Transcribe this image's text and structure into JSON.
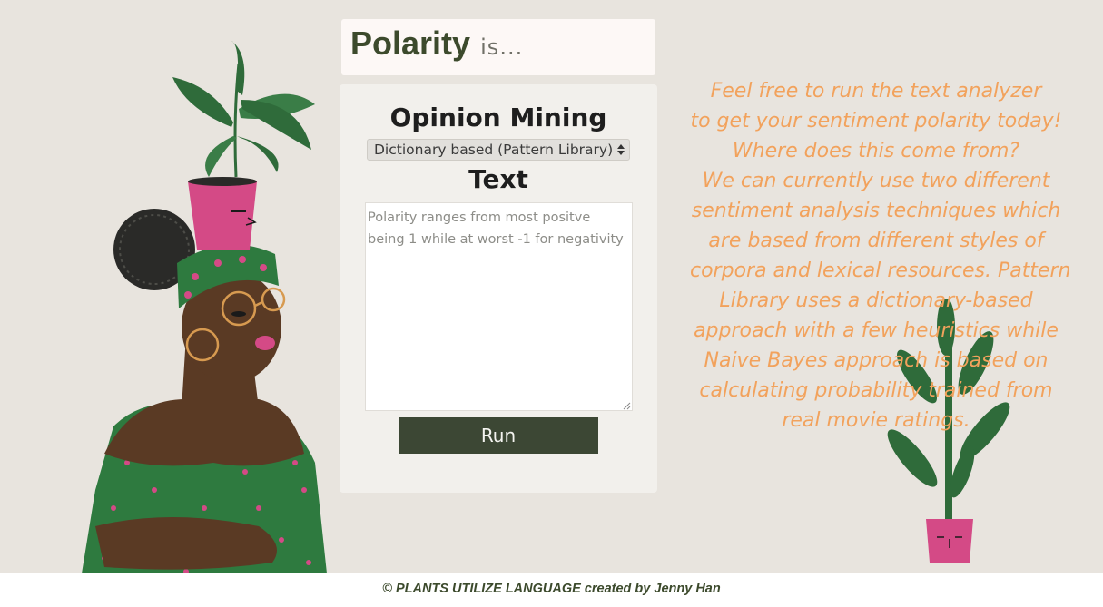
{
  "header": {
    "title_main": "Polarity",
    "title_suffix": "is..."
  },
  "panel": {
    "heading": "Opinion Mining",
    "select": {
      "value": "Dictionary based (Pattern Library)"
    },
    "text_heading": "Text",
    "textarea": {
      "placeholder": "Polarity ranges from most positve being 1 while at worst -1 for negativity"
    },
    "run_label": "Run"
  },
  "side": {
    "lines": [
      "Feel free to run the text analyzer",
      "to get your sentiment polarity today!",
      "Where does this come from?",
      "We can currently use two different",
      "sentiment analysis techniques which",
      "are based from different styles of",
      "corpora and lexical resources. Pattern",
      "Library uses a dictionary-based",
      "approach with a few heuristics while",
      "Naive Bayes approach is based on",
      "calculating probability trained from",
      "real movie ratings."
    ]
  },
  "footer": {
    "text": "© PLANTS UTILIZE LANGUAGE created by Jenny Han"
  },
  "colors": {
    "background": "#e8e4de",
    "accent_orange": "#f2a25c",
    "dark_green": "#3c4a2c",
    "button": "#3c4734",
    "pink": "#d44a86",
    "plant_green": "#2f6b3a"
  },
  "icons": {
    "select_arrow": "up-down-arrows-icon",
    "resize_grip": "resize-grip-icon"
  }
}
